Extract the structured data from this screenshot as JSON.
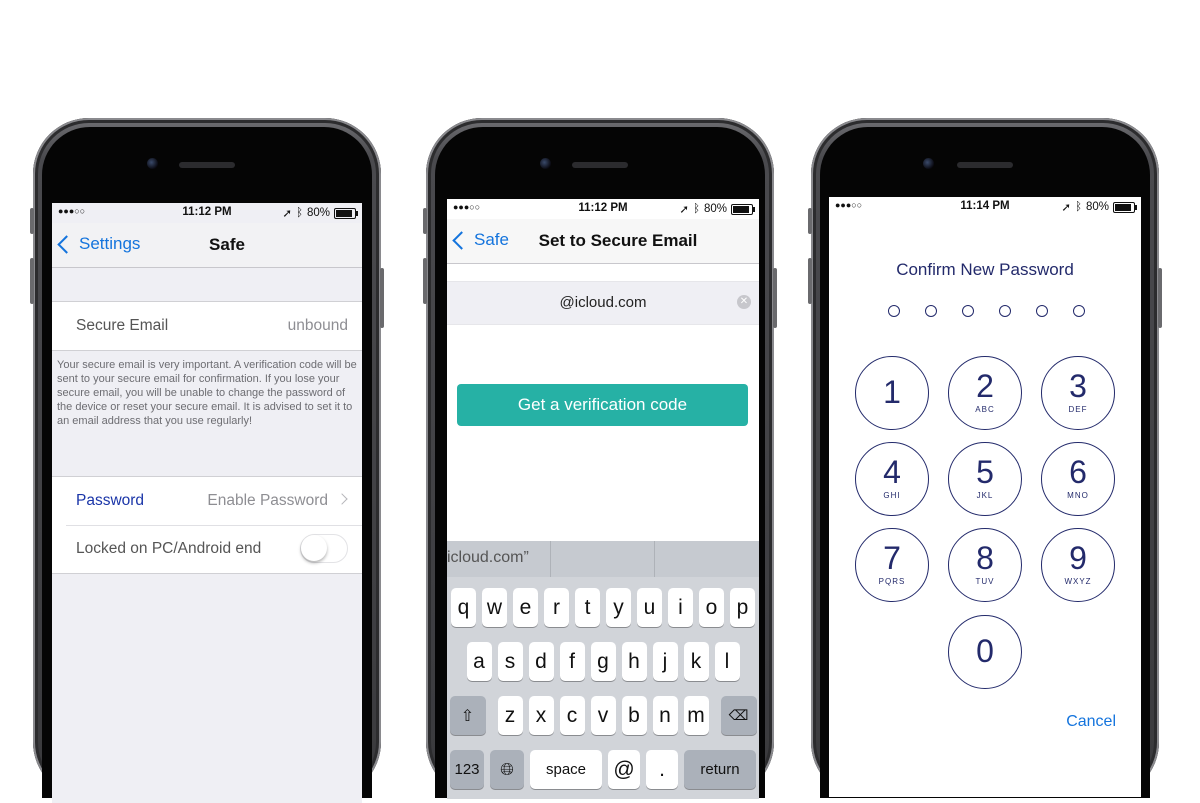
{
  "phone1": {
    "status": {
      "signal": "●●●○○",
      "time": "11:12 PM",
      "battery": "80%"
    },
    "nav": {
      "back": "Settings",
      "title": "Safe"
    },
    "secure_email": {
      "label": "Secure Email",
      "value": "unbound"
    },
    "description": "Your secure email is very important. A verification code will be sent to your secure email for confirmation.  If you lose your secure email, you will be unable to change the password of the device or reset your secure email.  It is advised to set it to an email address that you use regularly!",
    "password": {
      "label": "Password",
      "value": "Enable Password"
    },
    "locked": {
      "label": "Locked on PC/Android end",
      "toggle_on": false
    }
  },
  "phone2": {
    "status": {
      "signal": "●●●○○",
      "time": "11:12 PM",
      "battery": "80%"
    },
    "nav": {
      "back": "Safe",
      "title": "Set to Secure Email"
    },
    "email_value": "@icloud.com",
    "button": "Get a verification code",
    "suggestion": "icloud.com”",
    "keys": {
      "row1": [
        "q",
        "w",
        "e",
        "r",
        "t",
        "y",
        "u",
        "i",
        "o",
        "p"
      ],
      "row2": [
        "a",
        "s",
        "d",
        "f",
        "g",
        "h",
        "j",
        "k",
        "l"
      ],
      "row3": [
        "z",
        "x",
        "c",
        "v",
        "b",
        "n",
        "m"
      ],
      "num_key": "123",
      "space": "space",
      "at": "@",
      "dot": ".",
      "return": "return"
    }
  },
  "phone3": {
    "status": {
      "signal": "●●●○○",
      "time": "11:14 PM",
      "battery": "80%"
    },
    "title": "Confirm New Password",
    "digits": [
      {
        "d": "1",
        "l": ""
      },
      {
        "d": "2",
        "l": "ABC"
      },
      {
        "d": "3",
        "l": "DEF"
      },
      {
        "d": "4",
        "l": "GHI"
      },
      {
        "d": "5",
        "l": "JKL"
      },
      {
        "d": "6",
        "l": "MNO"
      },
      {
        "d": "7",
        "l": "PQRS"
      },
      {
        "d": "8",
        "l": "TUV"
      },
      {
        "d": "9",
        "l": "WXYZ"
      },
      {
        "d": "0",
        "l": ""
      }
    ],
    "cancel": "Cancel"
  },
  "colors": {
    "accent": "#1474dd",
    "teal": "#26b1a5",
    "keypad": "#232a6b"
  }
}
